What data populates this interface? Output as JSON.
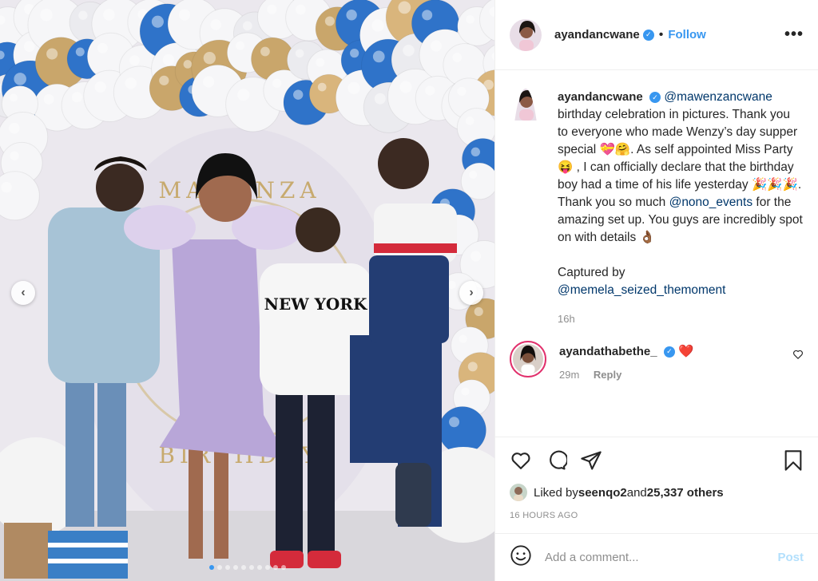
{
  "post": {
    "username": "ayandancwane",
    "follow_label": "Follow",
    "more_label": "•••",
    "bullet": "•"
  },
  "caption": {
    "username": "ayandancwane",
    "mention1": "@mawenzancwane",
    "text1": " birthday celebration in pictures. Thank you to everyone who made Wenzy’s day supper special 💝🤗. As self appointed Miss Party 😝 , I can officially declare that the birthday boy had a time of his life yesterday 🎉🎉🎉. Thank you so much ",
    "mention2": "@nono_events",
    "text2": " for the amazing set up. You guys are incredibly spot on with details 👌🏾",
    "captured_by": "Captured by",
    "mention3": "@memela_seized_themoment",
    "time": "16h"
  },
  "comment": {
    "username": "ayandathabethe_",
    "text": "❤️",
    "time": "29m",
    "reply_label": "Reply"
  },
  "likes": {
    "prefix": "Liked by ",
    "user": "seenqo2",
    "and": " and ",
    "count": "25,337 others"
  },
  "time_ago": "16 HOURS AGO",
  "add_comment": {
    "placeholder": "Add a comment...",
    "post_label": "Post"
  },
  "carousel": {
    "slide_count": 10,
    "active_index": 0
  },
  "colors": {
    "accent": "#3897f0",
    "like_red": "#ed4956"
  },
  "photo": {
    "backdrop_text_top": "MAWENZA",
    "backdrop_text_bottom": "BIRTHDAY",
    "shirt_text": "NEW YORK"
  }
}
